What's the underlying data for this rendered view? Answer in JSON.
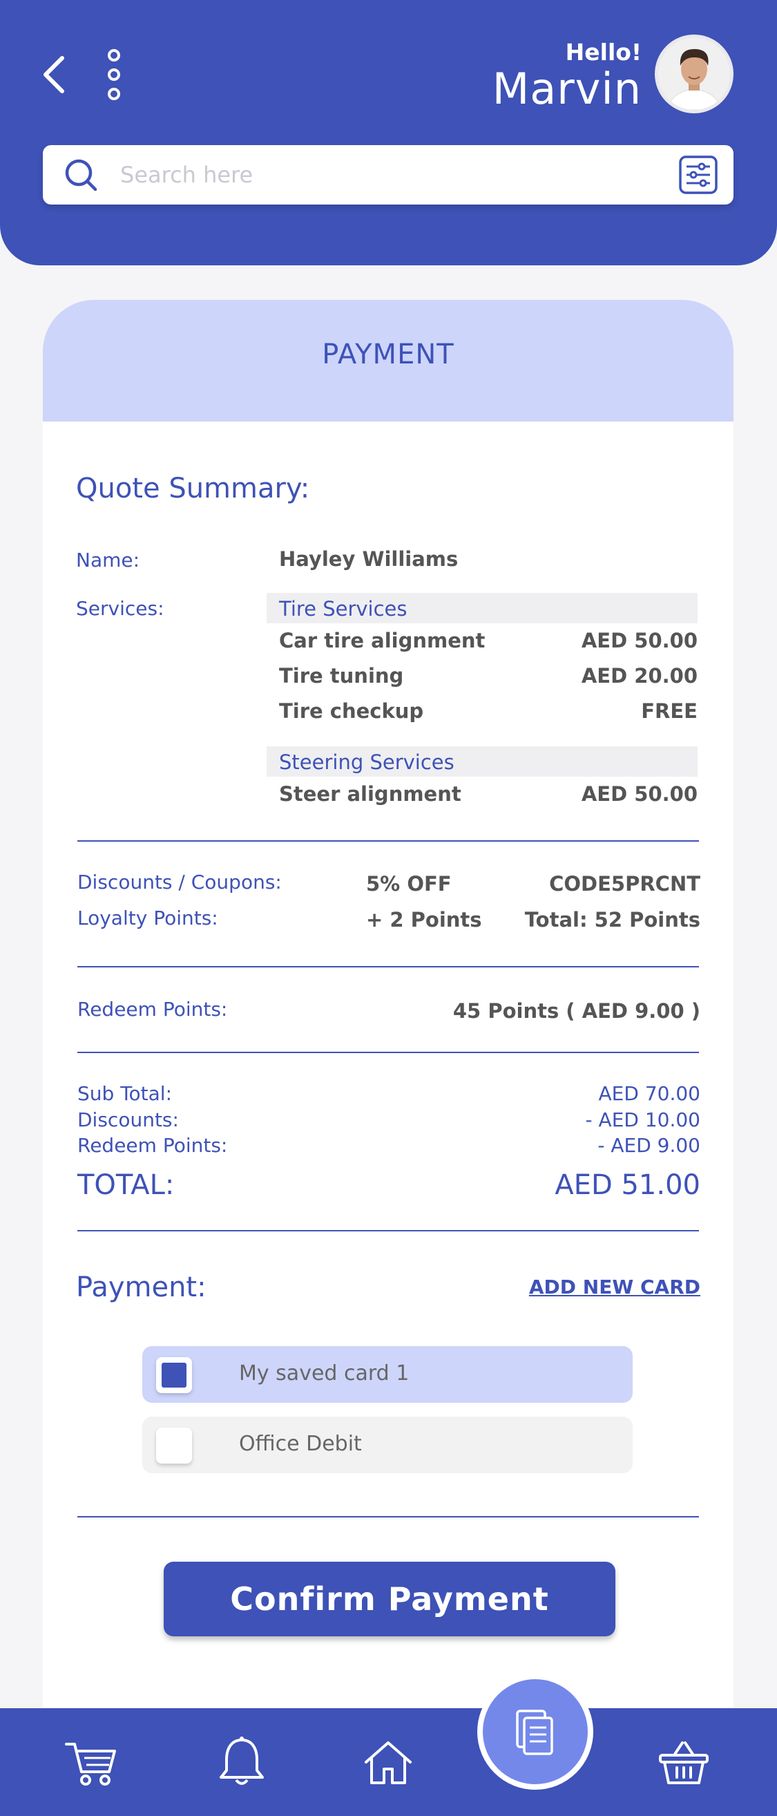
{
  "header": {
    "greeting": "Hello!",
    "username": "Marvin",
    "search_placeholder": "Search here"
  },
  "card": {
    "title": "PAYMENT",
    "quote_summary_label": "Quote Summary:",
    "name_label": "Name:",
    "name_value": "Hayley Williams",
    "services_label": "Services:",
    "service_groups": [
      {
        "category": "Tire Services",
        "items": [
          {
            "name": "Car tire alignment",
            "price": "AED 50.00"
          },
          {
            "name": "Tire tuning",
            "price": "AED 20.00"
          },
          {
            "name": "Tire checkup",
            "price": "FREE"
          }
        ]
      },
      {
        "category": "Steering Services",
        "items": [
          {
            "name": "Steer alignment",
            "price": "AED 50.00"
          }
        ]
      }
    ],
    "discounts_label": "Discounts / Coupons:",
    "discount_value": "5% OFF",
    "discount_code": "CODE5PRCNT",
    "loyalty_label": "Loyalty Points:",
    "loyalty_value": "+ 2 Points",
    "loyalty_total": "Total:  52 Points",
    "redeem_label": "Redeem Points:",
    "redeem_value": "45 Points ( AED 9.00 )",
    "subtotal_label": "Sub Total:",
    "subtotal_value": "AED 70.00",
    "discounts_sum_label": "Discounts:",
    "discounts_sum_value": "- AED 10.00",
    "redeem_sum_label": "Redeem Points:",
    "redeem_sum_value": "- AED 9.00",
    "total_label": "TOTAL:",
    "total_value": "AED 51.00",
    "payment_label": "Payment:",
    "add_card_label": "ADD NEW CARD",
    "payment_options": [
      {
        "label": "My saved card 1",
        "selected": true
      },
      {
        "label": "Office Debit",
        "selected": false
      }
    ],
    "confirm_label": "Confirm Payment"
  },
  "nav": {
    "icons": [
      "cart-icon",
      "bell-icon",
      "home-icon",
      "documents-icon",
      "basket-icon"
    ]
  },
  "colors": {
    "primary": "#3e52b7",
    "light_accent": "#cdd5fb",
    "fab": "#7488ea"
  }
}
